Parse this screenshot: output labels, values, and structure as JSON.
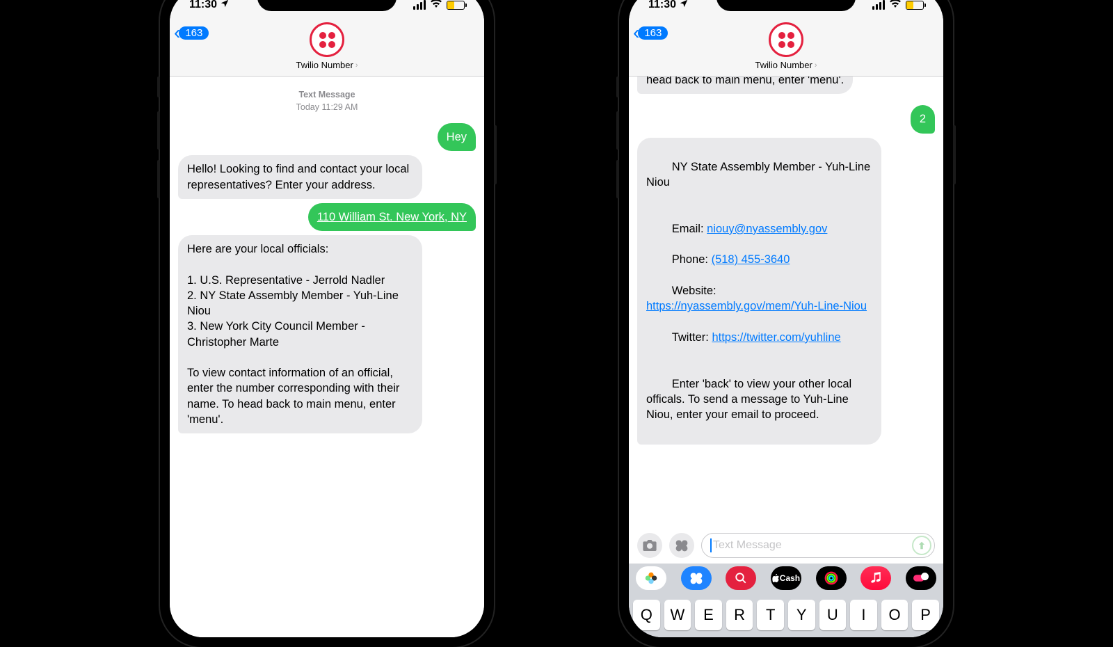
{
  "status": {
    "time": "11:30",
    "badge": "163",
    "contact_name": "Twilio Number"
  },
  "phone1": {
    "timestamp_label": "Text Message",
    "timestamp_time": "Today 11:29 AM",
    "msg_out_1": "Hey",
    "msg_in_1": "Hello! Looking to find and contact your local representatives? Enter your address.",
    "msg_out_2": "110 William St. New York, NY",
    "msg_in_2": "Here are your local officials:\n\n1. U.S. Representative - Jerrold Nadler\n2. NY State Assembly Member - Yuh-Line Niou\n3. New York City Council Member - Christopher Marte\n\nTo view contact information of an official, enter the number corresponding with their name. To head back to main menu, enter 'menu'."
  },
  "phone2": {
    "partial_top": "head back to main menu, enter 'menu'.",
    "msg_out_1": "2",
    "detail": {
      "header": "NY State Assembly Member - Yuh-Line Niou",
      "email_label": "Email: ",
      "email": "niouy@nyassembly.gov",
      "phone_label": "Phone: ",
      "phone": "(518) 455-3640",
      "website_label": "Website: ",
      "website": "https://nyassembly.gov/mem/Yuh-Line-Niou",
      "twitter_label": "Twitter: ",
      "twitter": "https://twitter.com/yuhline",
      "footer": "Enter 'back' to view your other local officals. To send a message to Yuh-Line Niou, enter your email to proceed."
    },
    "input_placeholder": "Text Message",
    "apple_cash": "Cash",
    "keys": [
      "Q",
      "W",
      "E",
      "R",
      "T",
      "Y",
      "U",
      "I",
      "O",
      "P"
    ]
  }
}
